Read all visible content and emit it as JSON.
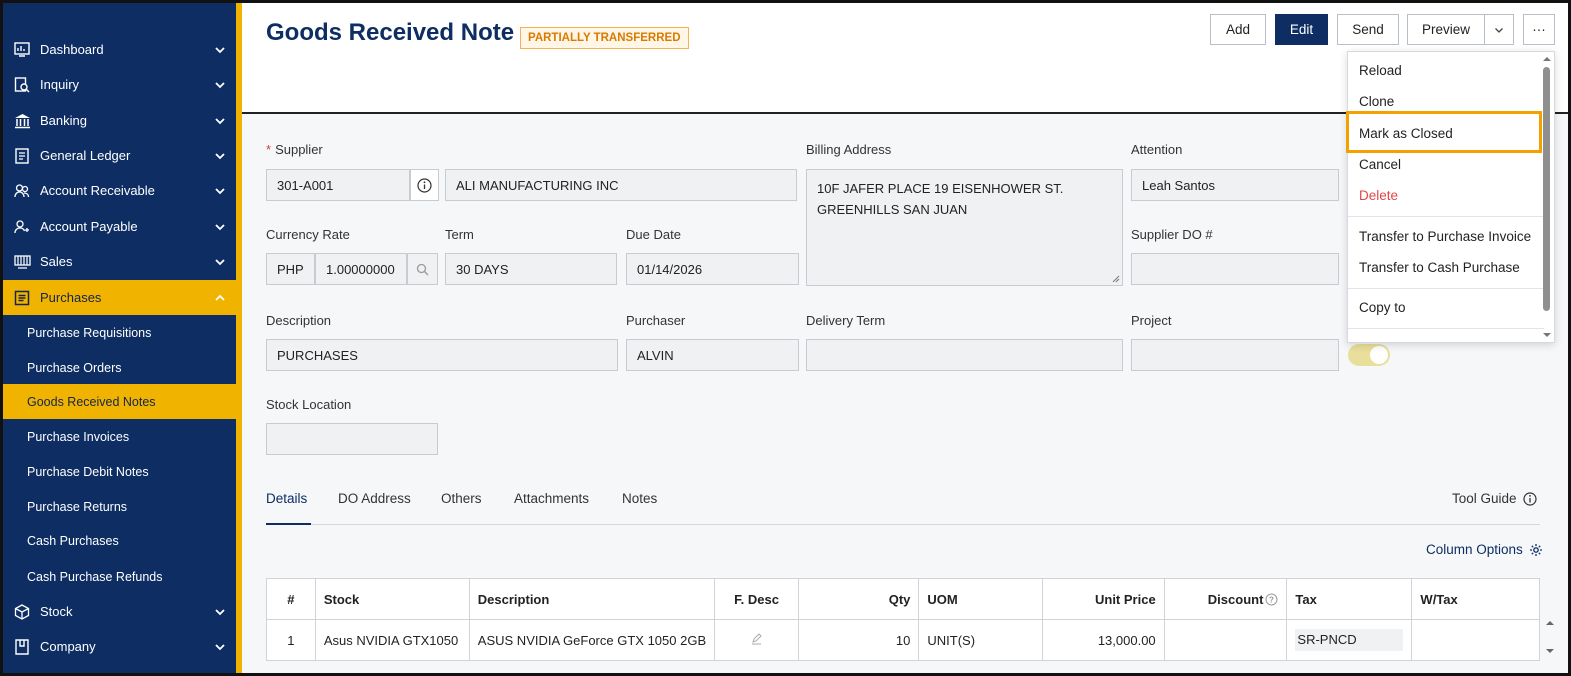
{
  "sidebar": {
    "items": [
      {
        "label": "Dashboard",
        "icon": "dashboard-icon"
      },
      {
        "label": "Inquiry",
        "icon": "inquiry-icon"
      },
      {
        "label": "Banking",
        "icon": "bank-icon"
      },
      {
        "label": "General Ledger",
        "icon": "ledger-icon"
      },
      {
        "label": "Account Receivable",
        "icon": "receivable-icon"
      },
      {
        "label": "Account Payable",
        "icon": "payable-icon"
      },
      {
        "label": "Sales",
        "icon": "sales-icon"
      },
      {
        "label": "Purchases",
        "icon": "purchases-icon"
      },
      {
        "label": "Stock",
        "icon": "stock-icon"
      },
      {
        "label": "Company",
        "icon": "company-icon"
      }
    ],
    "purchases_sub": [
      "Purchase Requisitions",
      "Purchase Orders",
      "Goods Received Notes",
      "Purchase Invoices",
      "Purchase Debit Notes",
      "Purchase Returns",
      "Cash Purchases",
      "Cash Purchase Refunds"
    ]
  },
  "header": {
    "title": "Goods Received Note",
    "status": "PARTIALLY TRANSFERRED",
    "buttons": {
      "add": "Add",
      "edit": "Edit",
      "send": "Send",
      "preview": "Preview",
      "more": "···"
    }
  },
  "menu": {
    "items": [
      "Reload",
      "Clone",
      "Mark as Closed",
      "Cancel",
      "Delete",
      "Transfer to Purchase Invoice",
      "Transfer to Cash Purchase",
      "Copy to"
    ]
  },
  "form": {
    "supplier_label": "Supplier",
    "supplier_code": "301-A001",
    "supplier_name": "ALI MANUFACTURING INC",
    "billing_label": "Billing Address",
    "billing_line1": "10F JAFER PLACE 19 EISENHOWER ST.",
    "billing_line2": "GREENHILLS SAN JUAN",
    "attention_label": "Attention",
    "attention": "Leah Santos",
    "currency_label": "Currency Rate",
    "currency": "PHP",
    "rate": "1.00000000",
    "term_label": "Term",
    "term": "30 DAYS",
    "due_label": "Due Date",
    "due": "01/14/2026",
    "supplier_do_label": "Supplier DO #",
    "supplier_do": "",
    "description_label": "Description",
    "description": "PURCHASES",
    "purchaser_label": "Purchaser",
    "purchaser": "ALVIN",
    "delivery_label": "Delivery Term",
    "delivery": "",
    "project_label": "Project",
    "project": "",
    "stock_location_label": "Stock Location",
    "stock_location": ""
  },
  "tabs": [
    "Details",
    "DO Address",
    "Others",
    "Attachments",
    "Notes"
  ],
  "tool_guide": "Tool Guide",
  "column_options": "Column Options",
  "table": {
    "headers": [
      "#",
      "Stock",
      "Description",
      "F. Desc",
      "Qty",
      "UOM",
      "Unit Price",
      "Discount",
      "Tax",
      "W/Tax"
    ],
    "rows": [
      {
        "no": "1",
        "stock": "Asus NVIDIA GTX1050",
        "description": "ASUS NVIDIA GeForce GTX 1050 2GB",
        "qty": "10",
        "uom": "UNIT(S)",
        "unit_price": "13,000.00",
        "discount": "",
        "tax": "SR-PNCD",
        "wtax": ""
      }
    ]
  },
  "colors": {
    "sidebar": "#0d2d63",
    "accent": "#f0b400",
    "primary": "#0d2d63",
    "highlight": "#f2a100"
  }
}
